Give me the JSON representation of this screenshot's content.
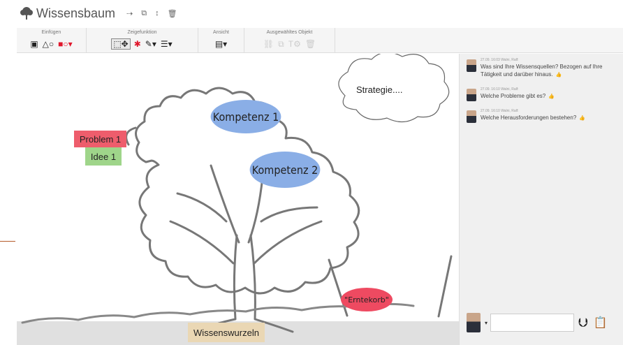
{
  "app": {
    "title": "Wissensbaum"
  },
  "titlebar": {
    "buttons": [
      {
        "name": "share-button",
        "icon": "share-icon",
        "glyph": "⇢"
      },
      {
        "name": "copy-button",
        "icon": "copy-icon",
        "glyph": "⧉"
      },
      {
        "name": "export-button",
        "icon": "export-icon",
        "glyph": "↕"
      },
      {
        "name": "delete-button",
        "icon": "trash-icon",
        "glyph": "🗑"
      }
    ]
  },
  "ribbon": {
    "groups": [
      {
        "label": "Einfügen",
        "items": [
          {
            "name": "insert-image-button",
            "icon": "image-icon",
            "glyph": "▣",
            "state": "normal"
          },
          {
            "name": "insert-shapes-button",
            "icon": "shapes-icon",
            "glyph": "△○",
            "state": "normal"
          },
          {
            "name": "insert-note-button",
            "icon": "note-color-icon",
            "glyph": "■○▾",
            "state": "red"
          }
        ]
      },
      {
        "label": "Zeigefunktion",
        "items": [
          {
            "name": "select-tool-button",
            "icon": "select-move-icon",
            "glyph": "⬚✥",
            "state": "selected"
          },
          {
            "name": "laser-pointer-button",
            "icon": "laser-dot-icon",
            "glyph": "✱",
            "state": "red"
          },
          {
            "name": "pen-tool-button",
            "icon": "pen-icon",
            "glyph": "✎▾",
            "state": "normal"
          },
          {
            "name": "line-style-button",
            "icon": "line-style-icon",
            "glyph": "☰▾",
            "state": "normal"
          }
        ]
      },
      {
        "label": "Ansicht",
        "items": [
          {
            "name": "view-mode-button",
            "icon": "view-layout-icon",
            "glyph": "▤▾",
            "state": "normal"
          }
        ]
      },
      {
        "label": "Ausgewähltes Objekt",
        "items": [
          {
            "name": "object-link-button",
            "icon": "link-icon",
            "glyph": "⛓",
            "state": "dim"
          },
          {
            "name": "object-copy-button",
            "icon": "duplicate-icon",
            "glyph": "⧉",
            "state": "dim"
          },
          {
            "name": "object-text-button",
            "icon": "text-icon",
            "glyph": "T⚙",
            "state": "dim"
          },
          {
            "name": "object-delete-button",
            "icon": "trash-icon",
            "glyph": "🗑",
            "state": "dim"
          }
        ]
      }
    ]
  },
  "canvas": {
    "ellipses": [
      {
        "name": "kompetenz-1-ellipse",
        "text": "Kompetenz 1"
      },
      {
        "name": "kompetenz-2-ellipse",
        "text": "Kompetenz 2"
      },
      {
        "name": "erntekorb-ellipse",
        "text": "\"Erntekorb\""
      }
    ],
    "cards": [
      {
        "name": "problem-1-card",
        "text": "Problem 1"
      },
      {
        "name": "idee-1-card",
        "text": "Idee 1"
      },
      {
        "name": "wissenswurzeln-card",
        "text": "Wissenswurzeln"
      }
    ],
    "cloud_text": "Strategie....",
    "colors": {
      "ellipse_blue": "#8aaee6",
      "ellipse_red": "#ee4a61",
      "problem_red": "#ee5d6c",
      "idee_green": "#9fd58a",
      "roots_tan": "#ead7b4",
      "ground": "#e0e0e0"
    }
  },
  "chat": {
    "messages": [
      {
        "meta": "27.09. 16:03 Walni, Ralf:",
        "text": "Was sind Ihre Wissensquellen? Bezogen auf Ihre Tätigkeit und darüber hinaus."
      },
      {
        "meta": "27.09. 16:10 Walni, Ralf:",
        "text": "Welche Probleme gibt es?"
      },
      {
        "meta": "27.09. 16:10 Walni, Ralf:",
        "text": "Welche Herausforderungen bestehen?"
      }
    ],
    "input": {
      "value": "",
      "placeholder": ""
    },
    "send_icon": "send-icon",
    "clipboard_icon": "clipboard-icon"
  }
}
